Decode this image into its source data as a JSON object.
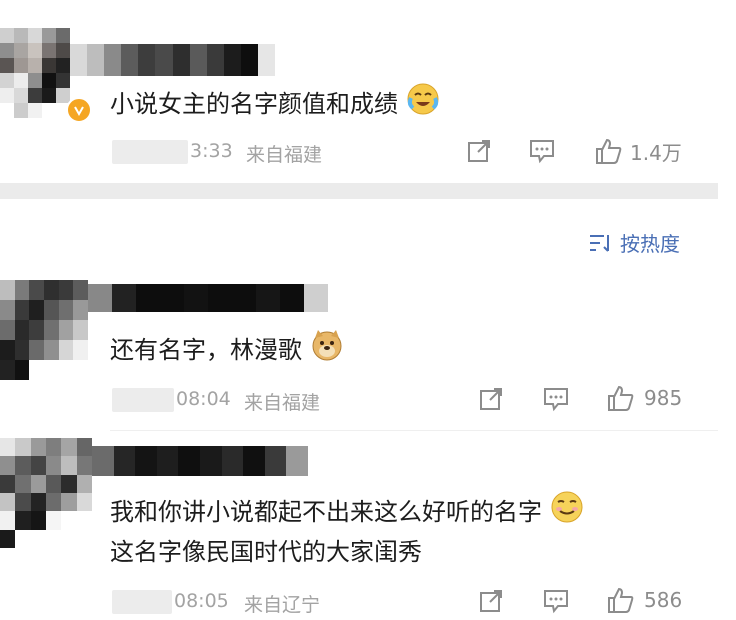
{
  "comments": [
    {
      "text": "小说女主的名字颜值和成绩",
      "time": "3:33",
      "source": "来自福建",
      "likes": "1.4万",
      "verified_badge": "v-badge-icon",
      "emoji": "crying-laughing-emoji"
    },
    {
      "text": "还有名字，林漫歌",
      "time": "08:04",
      "source": "来自福建",
      "likes": "985",
      "emoji": "doge-emoji"
    },
    {
      "text_line1": "我和你讲小说都起不出来这么好听的名字",
      "text_line2": "这名字像民国时代的大家闺秀",
      "time": "08:05",
      "source": "来自辽宁",
      "likes": "586",
      "emoji": "smirk-emoji"
    }
  ],
  "sort": {
    "label": "按热度",
    "icon": "sort-lines-icon"
  },
  "colors": {
    "accent": "#4a6fb5",
    "meta": "#a3a3a3",
    "verified": "#f5a623",
    "separator": "#ebebeb"
  }
}
